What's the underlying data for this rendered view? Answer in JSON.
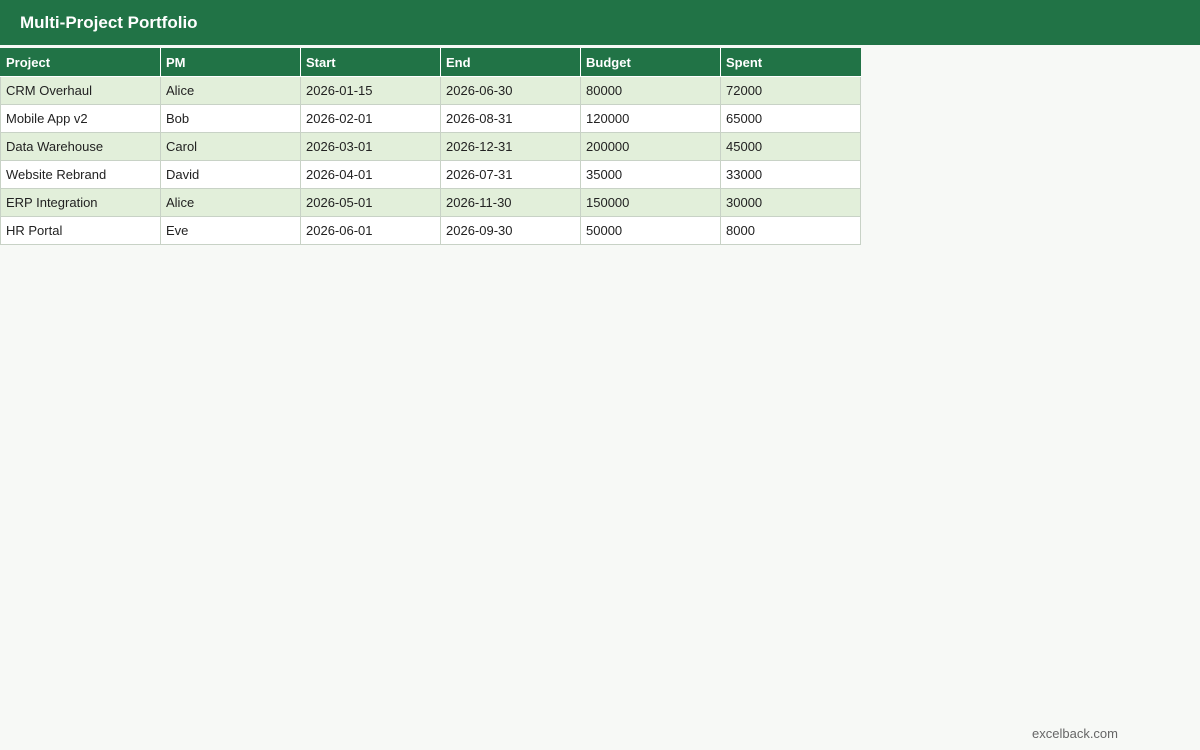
{
  "header": {
    "title": "Multi-Project Portfolio"
  },
  "table": {
    "columns": [
      "Project",
      "PM",
      "Start",
      "End",
      "Budget",
      "Spent"
    ],
    "rows": [
      [
        "CRM Overhaul",
        "Alice",
        "2026-01-15",
        "2026-06-30",
        "80000",
        "72000"
      ],
      [
        "Mobile App v2",
        "Bob",
        "2026-02-01",
        "2026-08-31",
        "120000",
        "65000"
      ],
      [
        "Data Warehouse",
        "Carol",
        "2026-03-01",
        "2026-12-31",
        "200000",
        "45000"
      ],
      [
        "Website Rebrand",
        "David",
        "2026-04-01",
        "2026-07-31",
        "35000",
        "33000"
      ],
      [
        "ERP Integration",
        "Alice",
        "2026-05-01",
        "2026-11-30",
        "150000",
        "30000"
      ],
      [
        "HR Portal",
        "Eve",
        "2026-06-01",
        "2026-09-30",
        "50000",
        "8000"
      ]
    ]
  },
  "footer": {
    "brand": "excelback.com"
  },
  "colors": {
    "header_bg": "#217346",
    "header_text": "#ffffff",
    "alt_row_bg": "#e2efda",
    "row_bg": "#ffffff",
    "page_bg": "#f7f9f6"
  }
}
